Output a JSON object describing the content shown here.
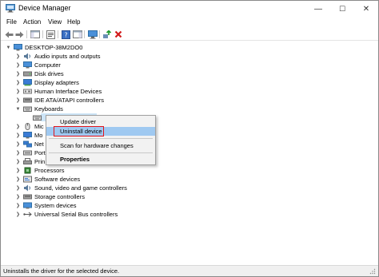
{
  "window": {
    "title": "Device Manager"
  },
  "titlebar": {
    "minimize": "—",
    "maximize": "☐",
    "close": "✕"
  },
  "menu": [
    "File",
    "Action",
    "View",
    "Help"
  ],
  "tree": {
    "root": "DESKTOP-38M2DO0",
    "items": [
      {
        "label": "Audio inputs and outputs",
        "expanded": false
      },
      {
        "label": "Computer",
        "expanded": false
      },
      {
        "label": "Disk drives",
        "expanded": false
      },
      {
        "label": "Display adapters",
        "expanded": false
      },
      {
        "label": "Human Interface Devices",
        "expanded": false
      },
      {
        "label": "IDE ATA/ATAPI controllers",
        "expanded": false
      },
      {
        "label": "Keyboards",
        "expanded": true
      },
      {
        "label": "Mic",
        "expanded": false
      },
      {
        "label": "Mo",
        "expanded": false
      },
      {
        "label": "Net",
        "expanded": false
      },
      {
        "label": "Port",
        "expanded": false
      },
      {
        "label": "Prin",
        "expanded": false
      },
      {
        "label": "Processors",
        "expanded": false
      },
      {
        "label": "Software devices",
        "expanded": false
      },
      {
        "label": "Sound, video and game controllers",
        "expanded": false
      },
      {
        "label": "Storage controllers",
        "expanded": false
      },
      {
        "label": "System devices",
        "expanded": false
      },
      {
        "label": "Universal Serial Bus controllers",
        "expanded": false
      }
    ]
  },
  "context_menu": {
    "items": [
      "Update driver",
      "Uninstall device",
      "Scan for hardware changes",
      "Properties"
    ],
    "highlighted": "Uninstall device"
  },
  "status": {
    "text": "Uninstalls the driver for the selected device."
  },
  "colors": {
    "selection": "#cce4f7",
    "highlight": "#9fc9f1",
    "callout": "#e3141b"
  }
}
